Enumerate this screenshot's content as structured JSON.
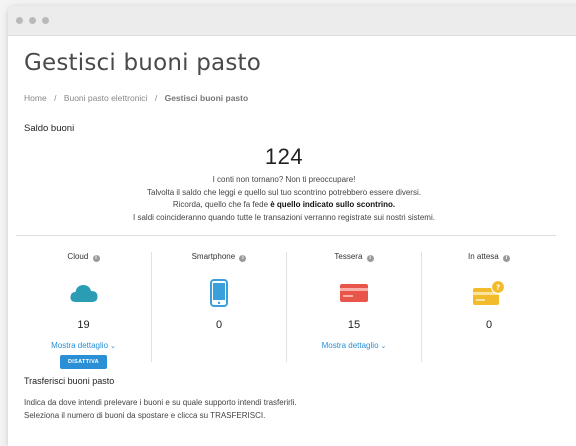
{
  "page": {
    "title": "Gestisci buoni pasto"
  },
  "breadcrumb": {
    "items": [
      "Home",
      "Buoni pasto elettronici"
    ],
    "current": "Gestisci buoni pasto"
  },
  "balance": {
    "label": "Saldo buoni",
    "value": "124",
    "note_line1": "I conti non tornano? Non ti preoccupare!",
    "note_line2": "Talvolta il saldo che leggi e quello sul tuo scontrino potrebbero essere diversi.",
    "note_line3_prefix": "Ricorda, quello che fa fede ",
    "note_line3_bold": "è quello indicato sullo scontrino.",
    "note_line4": "I saldi coincideranno quando tutte le transazioni verranno registrate sui nostri sistemi."
  },
  "cards": [
    {
      "title": "Cloud",
      "count": "19",
      "link": "Mostra dettaglio",
      "button": "DISATTIVA",
      "icon": "cloud-icon",
      "color": "#2a9db5"
    },
    {
      "title": "Smartphone",
      "count": "0",
      "icon": "smartphone-icon",
      "color": "#3aa0dc"
    },
    {
      "title": "Tessera",
      "count": "15",
      "link": "Mostra dettaglio",
      "icon": "card-icon",
      "color": "#e8564a"
    },
    {
      "title": "In attesa",
      "count": "0",
      "icon": "pending-card-icon",
      "color": "#f2bb2b"
    }
  ],
  "transfer": {
    "title": "Trasferisci buoni pasto",
    "line1": "Indica da dove intendi prelevare i buoni e su quale supporto intendi trasferirli.",
    "line2": "Seleziona il numero di buoni da spostare e clicca su TRASFERISCI."
  },
  "colors": {
    "accent": "#2b8fd6",
    "divider": "#dddddd"
  }
}
